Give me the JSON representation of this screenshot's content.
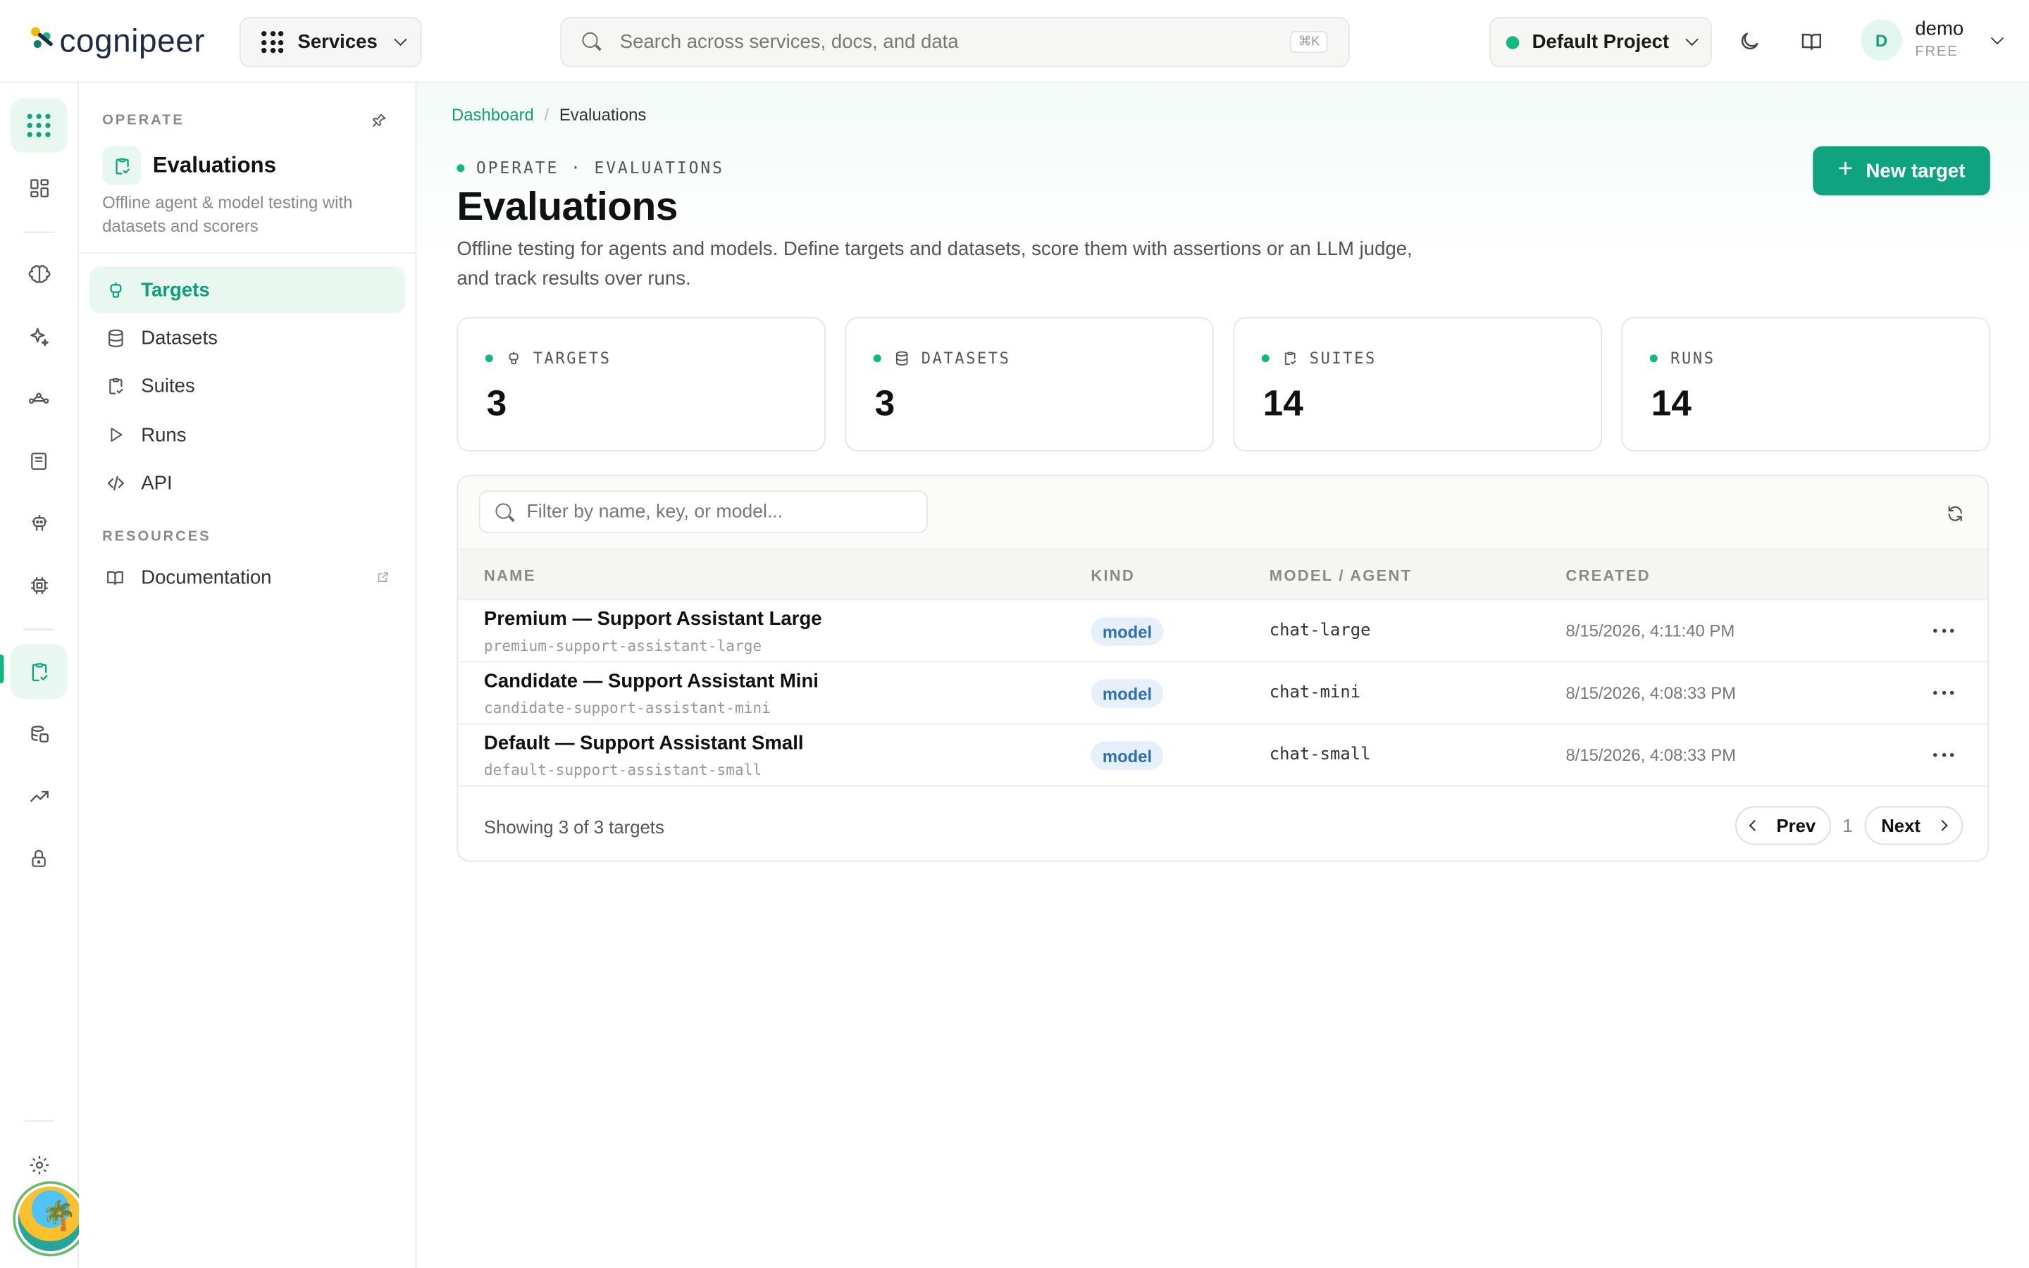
{
  "topbar": {
    "logo_text": "cognipeer",
    "services_label": "Services",
    "search_placeholder": "Search across services, docs, and data",
    "search_shortcut": "⌘K",
    "project_label": "Default Project",
    "user_initial": "D",
    "user_name": "demo",
    "user_plan": "FREE"
  },
  "colors": {
    "accent": "#10a37f",
    "accent_light": "#e8f8f1",
    "badge_bg": "#e6f0fb",
    "badge_text": "#2f6fb8"
  },
  "rail": {
    "icons": [
      "apps-grid-icon",
      "dashboard-icon",
      "brain-icon",
      "sparkles-icon",
      "flow-icon",
      "book-icon",
      "robot-icon",
      "chip-icon",
      "evaluations-icon",
      "data-icon",
      "analytics-icon",
      "lock-icon",
      "settings-icon"
    ],
    "active": "evaluations-icon"
  },
  "sidebar": {
    "section_label": "OPERATE",
    "service_title": "Evaluations",
    "service_desc": "Offline agent & model testing with datasets and scorers",
    "items": [
      {
        "label": "Targets",
        "icon": "robot-icon",
        "active": true
      },
      {
        "label": "Datasets",
        "icon": "database-icon",
        "active": false
      },
      {
        "label": "Suites",
        "icon": "clipboard-check-icon",
        "active": false
      },
      {
        "label": "Runs",
        "icon": "play-icon",
        "active": false
      },
      {
        "label": "API",
        "icon": "code-icon",
        "active": false
      }
    ],
    "resources_label": "RESOURCES",
    "documentation_label": "Documentation"
  },
  "main": {
    "breadcrumb": {
      "root": "Dashboard",
      "sep": "/",
      "current": "Evaluations"
    },
    "eyebrow": "OPERATE · EVALUATIONS",
    "title": "Evaluations",
    "subtitle": "Offline testing for agents and models. Define targets and datasets, score them with assertions or an LLM judge, and track results over runs.",
    "new_button": "New target",
    "new_button_icon": "+",
    "stats": [
      {
        "label": "TARGETS",
        "value": "3",
        "icon": "robot-icon"
      },
      {
        "label": "DATASETS",
        "value": "3",
        "icon": "database-icon"
      },
      {
        "label": "SUITES",
        "value": "14",
        "icon": "clipboard-check-icon"
      },
      {
        "label": "RUNS",
        "value": "14",
        "icon": ""
      }
    ],
    "table": {
      "filter_placeholder": "Filter by name, key, or model...",
      "columns": [
        "NAME",
        "KIND",
        "MODEL / AGENT",
        "CREATED"
      ],
      "rows": [
        {
          "name": "Premium — Support Assistant Large",
          "key": "premium-support-assistant-large",
          "kind": "model",
          "model": "chat-large",
          "created": "8/15/2026, 4:11:40 PM"
        },
        {
          "name": "Candidate — Support Assistant Mini",
          "key": "candidate-support-assistant-mini",
          "kind": "model",
          "model": "chat-mini",
          "created": "8/15/2026, 4:08:33 PM"
        },
        {
          "name": "Default — Support Assistant Small",
          "key": "default-support-assistant-small",
          "kind": "model",
          "model": "chat-small",
          "created": "8/15/2026, 4:08:33 PM"
        }
      ],
      "footer_text": "Showing 3 of 3 targets",
      "prev_label": "Prev",
      "page_number": "1",
      "next_label": "Next"
    }
  }
}
